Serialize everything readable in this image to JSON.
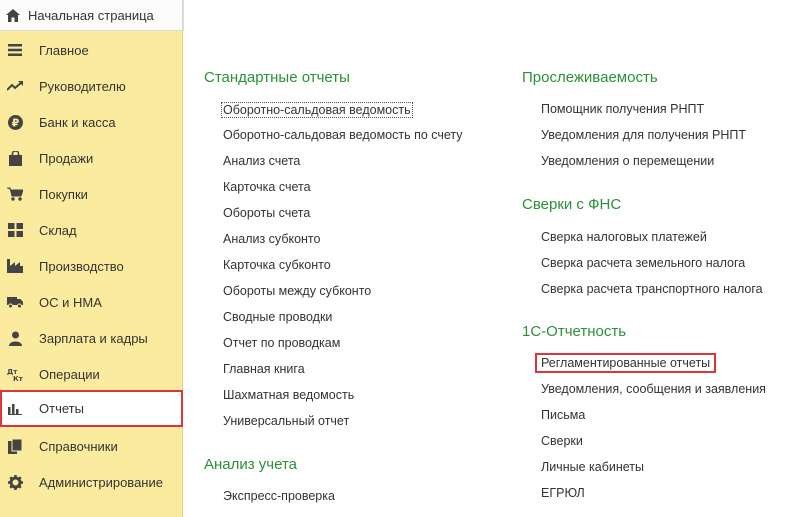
{
  "header": {
    "home_title": "Начальная страница"
  },
  "colors": {
    "sidebar_bg": "#fbeb9e",
    "section_green": "#2d8f3a",
    "highlight_red": "#d9353a"
  },
  "sidebar": {
    "items": [
      {
        "label": "Главное",
        "icon": "menu-icon"
      },
      {
        "label": "Руководителю",
        "icon": "trend-icon"
      },
      {
        "label": "Банк и касса",
        "icon": "ruble-icon"
      },
      {
        "label": "Продажи",
        "icon": "bag-icon"
      },
      {
        "label": "Покупки",
        "icon": "cart-icon"
      },
      {
        "label": "Склад",
        "icon": "grid-icon"
      },
      {
        "label": "Производство",
        "icon": "factory-icon"
      },
      {
        "label": "ОС и НМА",
        "icon": "truck-icon"
      },
      {
        "label": "Зарплата и кадры",
        "icon": "person-icon"
      },
      {
        "label": "Операции",
        "icon": "dt-kt-icon"
      },
      {
        "label": "Отчеты",
        "icon": "bar-chart-icon"
      },
      {
        "label": "Справочники",
        "icon": "books-icon"
      },
      {
        "label": "Администрирование",
        "icon": "gear-icon"
      }
    ]
  },
  "left_column": {
    "standard_title": "Стандартные отчеты",
    "standard_links": [
      "Оборотно-сальдовая ведомость",
      "Оборотно-сальдовая ведомость по счету",
      "Анализ счета",
      "Карточка счета",
      "Обороты счета",
      "Анализ субконто",
      "Карточка субконто",
      "Обороты между субконто",
      "Сводные проводки",
      "Отчет по проводкам",
      "Главная книга",
      "Шахматная ведомость",
      "Универсальный отчет"
    ],
    "analysis_title": "Анализ учета",
    "analysis_links": [
      "Экспресс-проверка"
    ]
  },
  "right_column": {
    "trace_title": "Прослеживаемость",
    "trace_links": [
      "Помощник получения РНПТ",
      "Уведомления для получения РНПТ",
      "Уведомления о перемещении"
    ],
    "fns_title": "Сверки с ФНС",
    "fns_links": [
      "Сверка налоговых платежей",
      "Сверка расчета земельного налога",
      "Сверка расчета транспортного налога"
    ],
    "otchet_title": "1С-Отчетность",
    "otchet_links": [
      "Регламентированные отчеты",
      "Уведомления, сообщения и заявления",
      "Письма",
      "Сверки",
      "Личные кабинеты",
      "ЕГРЮЛ"
    ]
  }
}
